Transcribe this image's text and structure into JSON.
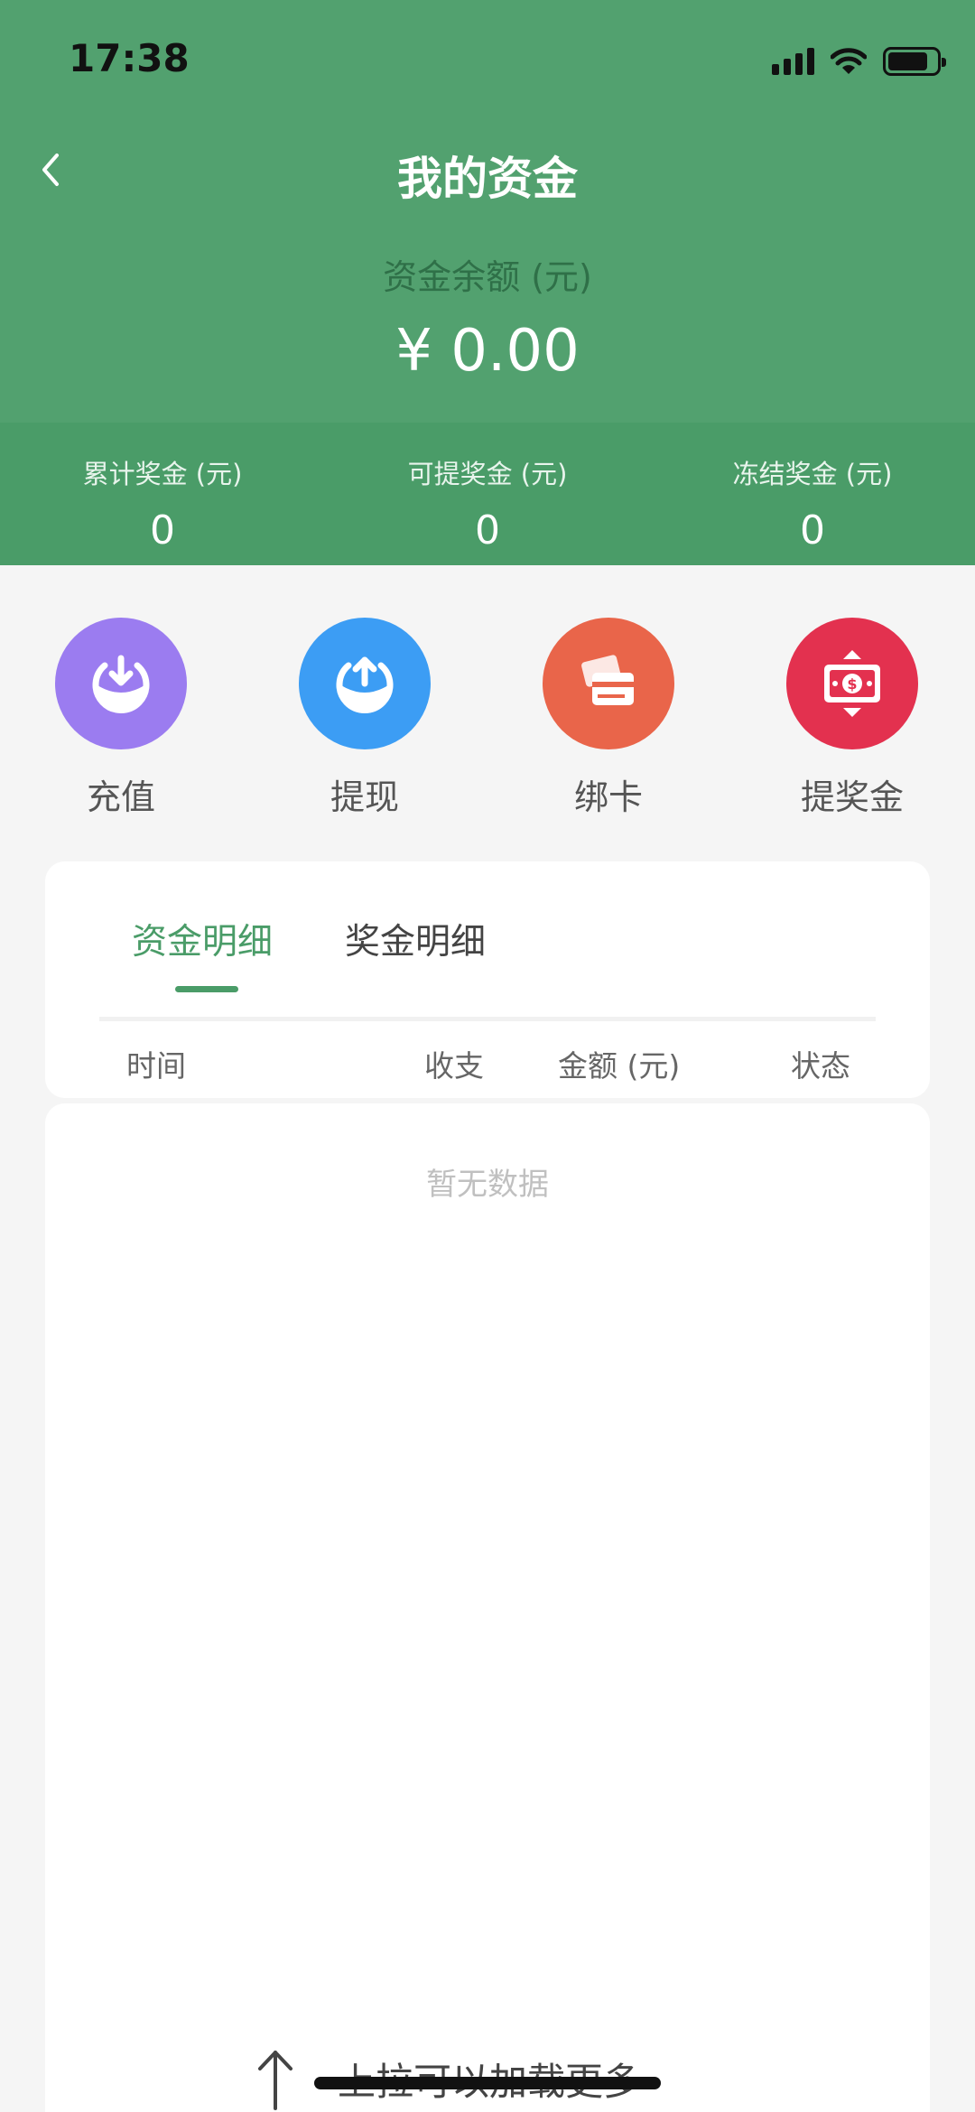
{
  "status_bar": {
    "time": "17:38"
  },
  "nav": {
    "title": "我的资金"
  },
  "balance": {
    "label": "资金余额 (元)",
    "value": "¥ 0.00"
  },
  "stats": [
    {
      "label": "累计奖金 (元)",
      "value": "0"
    },
    {
      "label": "可提奖金 (元)",
      "value": "0"
    },
    {
      "label": "冻结奖金 (元)",
      "value": "0"
    }
  ],
  "actions": [
    {
      "label": "充值",
      "icon": "recharge-icon",
      "color": "#9b7cf0"
    },
    {
      "label": "提现",
      "icon": "withdraw-icon",
      "color": "#3c9df4"
    },
    {
      "label": "绑卡",
      "icon": "bind-card-icon",
      "color": "#e9654a"
    },
    {
      "label": "提奖金",
      "icon": "bonus-withdraw-icon",
      "color": "#e3314f"
    }
  ],
  "tabs": [
    {
      "label": "资金明细",
      "active": true
    },
    {
      "label": "奖金明细",
      "active": false
    }
  ],
  "columns": [
    "时间",
    "收支",
    "金额 (元)",
    "状态"
  ],
  "empty_text": "暂无数据",
  "load_more_text": "上拉可以加载更多",
  "colors": {
    "primary": "#52a16f",
    "accent": "#4a9c68"
  }
}
